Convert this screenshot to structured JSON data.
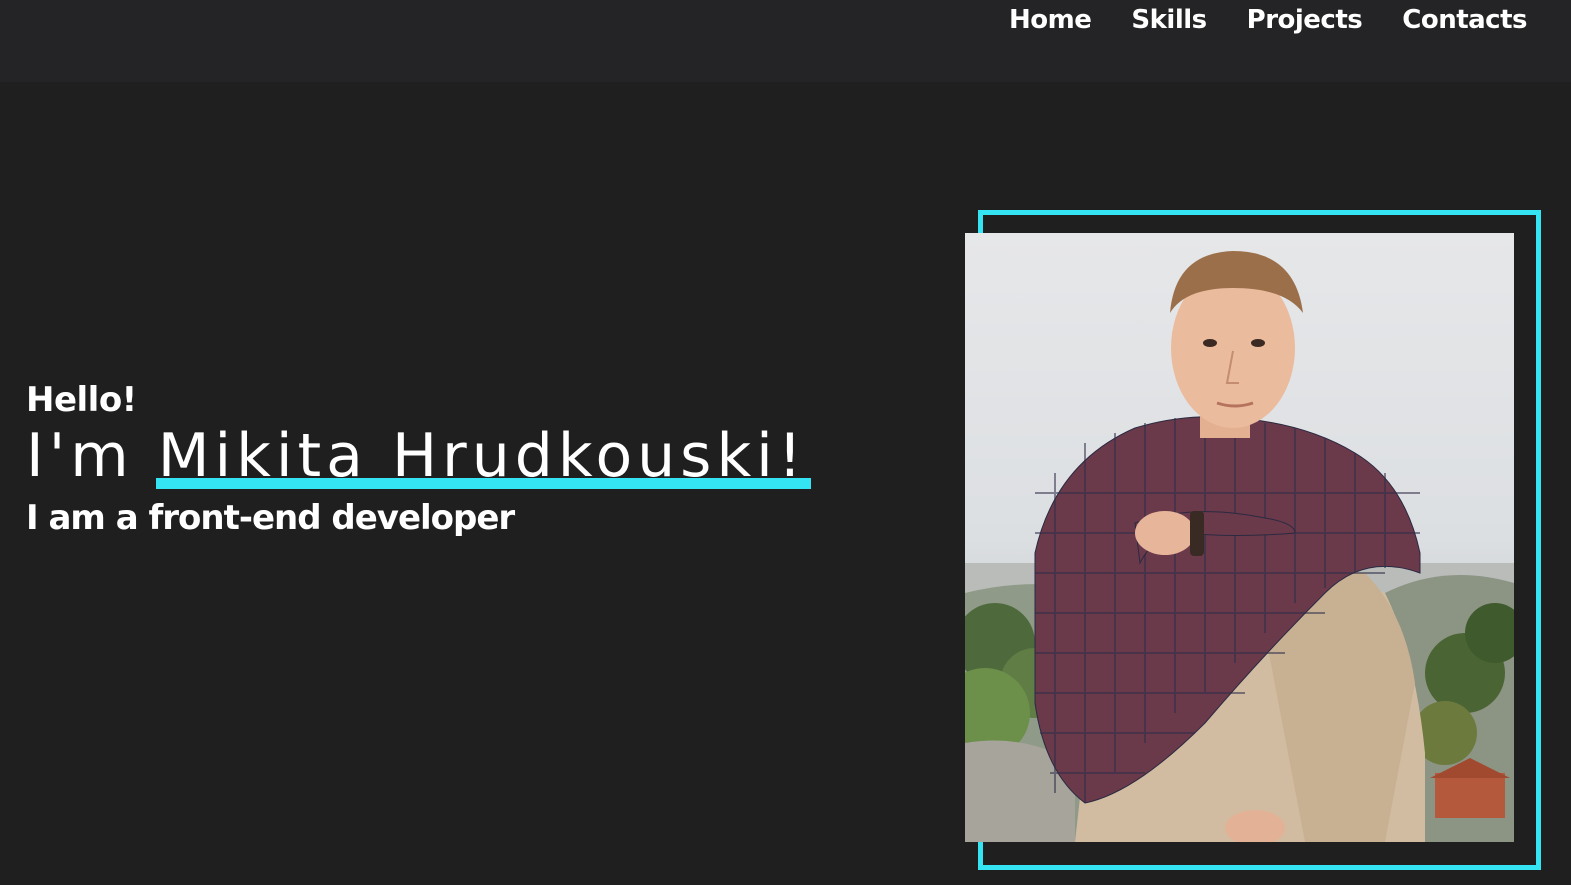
{
  "nav": {
    "items": [
      {
        "label": "Home"
      },
      {
        "label": "Skills"
      },
      {
        "label": "Projects"
      },
      {
        "label": "Contacts"
      }
    ]
  },
  "hero": {
    "greeting": "Hello!",
    "intro_prefix": "I'm ",
    "name": "Mikita Hrudkouski!",
    "role": "I am a front-end developer"
  },
  "colors": {
    "background": "#1f1f1f",
    "header": "#242426",
    "accent": "#35e4f2",
    "text": "#ffffff"
  }
}
